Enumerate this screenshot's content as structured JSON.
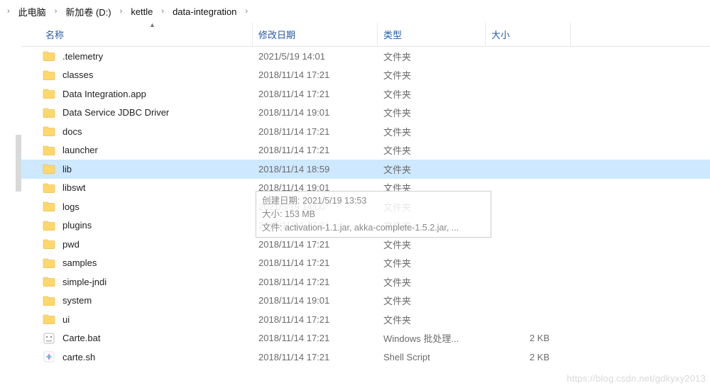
{
  "breadcrumb": {
    "items": [
      "此电脑",
      "新加卷 (D:)",
      "kettle",
      "data-integration"
    ],
    "sep": "›"
  },
  "columns": {
    "name": "名称",
    "date": "修改日期",
    "type": "类型",
    "size": "大小"
  },
  "selected_index": 6,
  "rows": [
    {
      "icon": "folder",
      "name": ".telemetry",
      "date": "2021/5/19 14:01",
      "type": "文件夹",
      "size": ""
    },
    {
      "icon": "folder",
      "name": "classes",
      "date": "2018/11/14 17:21",
      "type": "文件夹",
      "size": ""
    },
    {
      "icon": "folder",
      "name": "Data Integration.app",
      "date": "2018/11/14 17:21",
      "type": "文件夹",
      "size": ""
    },
    {
      "icon": "folder",
      "name": "Data Service JDBC Driver",
      "date": "2018/11/14 19:01",
      "type": "文件夹",
      "size": ""
    },
    {
      "icon": "folder",
      "name": "docs",
      "date": "2018/11/14 17:21",
      "type": "文件夹",
      "size": ""
    },
    {
      "icon": "folder",
      "name": "launcher",
      "date": "2018/11/14 17:21",
      "type": "文件夹",
      "size": ""
    },
    {
      "icon": "folder",
      "name": "lib",
      "date": "2018/11/14 18:59",
      "type": "文件夹",
      "size": ""
    },
    {
      "icon": "folder",
      "name": "libswt",
      "date": "2018/11/14 19:01",
      "type": "文件夹",
      "size": ""
    },
    {
      "icon": "folder",
      "name": "logs",
      "date": "2021/5/19 14:00",
      "type": "文件夹",
      "size": ""
    },
    {
      "icon": "folder",
      "name": "plugins",
      "date": "2018/11/14 17:21",
      "type": "文件夹",
      "size": ""
    },
    {
      "icon": "folder",
      "name": "pwd",
      "date": "2018/11/14 17:21",
      "type": "文件夹",
      "size": ""
    },
    {
      "icon": "folder",
      "name": "samples",
      "date": "2018/11/14 17:21",
      "type": "文件夹",
      "size": ""
    },
    {
      "icon": "folder",
      "name": "simple-jndi",
      "date": "2018/11/14 17:21",
      "type": "文件夹",
      "size": ""
    },
    {
      "icon": "folder",
      "name": "system",
      "date": "2018/11/14 19:01",
      "type": "文件夹",
      "size": ""
    },
    {
      "icon": "folder",
      "name": "ui",
      "date": "2018/11/14 17:21",
      "type": "文件夹",
      "size": ""
    },
    {
      "icon": "bat",
      "name": "Carte.bat",
      "date": "2018/11/14 17:21",
      "type": "Windows 批处理...",
      "size": "2 KB"
    },
    {
      "icon": "sh",
      "name": "carte.sh",
      "date": "2018/11/14 17:21",
      "type": "Shell Script",
      "size": "2 KB"
    }
  ],
  "tooltip": {
    "line1": "创建日期: 2021/5/19 13:53",
    "line2": "大小: 153 MB",
    "line3": "文件: activation-1.1.jar, akka-complete-1.5.2.jar, ..."
  },
  "watermark": "https://blog.csdn.net/gdkyxy2013"
}
